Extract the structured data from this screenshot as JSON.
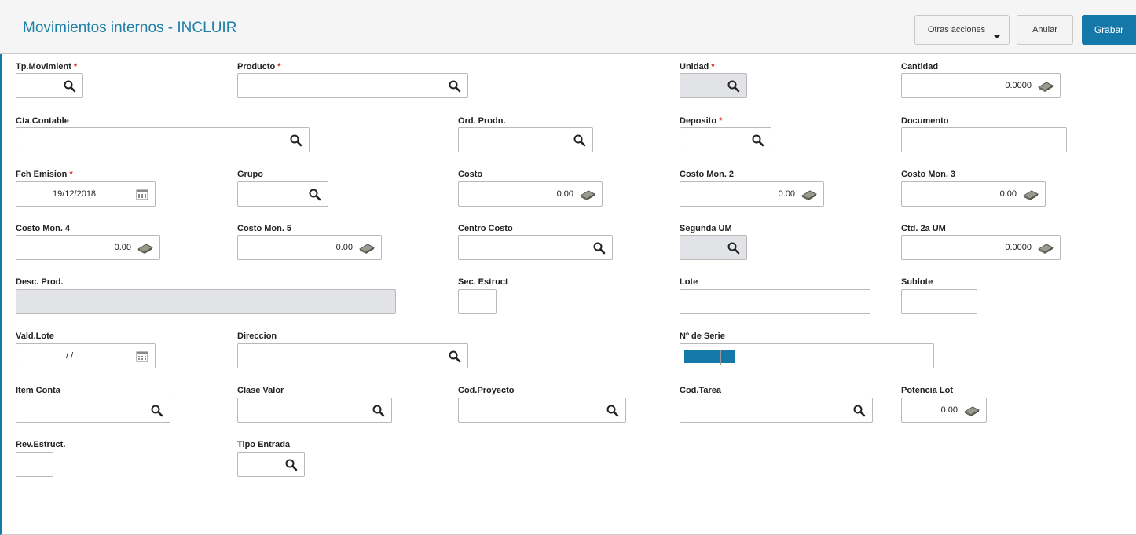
{
  "header": {
    "title": "Movimientos internos - INCLUIR",
    "buttons": {
      "more": "Otras acciones",
      "cancel": "Anular",
      "save": "Grabar"
    }
  },
  "required_mark": "*",
  "fields": {
    "tp_movimiento": {
      "label": "Tp.Movimient",
      "value": ""
    },
    "producto": {
      "label": "Producto",
      "value": ""
    },
    "unidad": {
      "label": "Unidad",
      "value": ""
    },
    "cantidad": {
      "label": "Cantidad",
      "value": "0.0000"
    },
    "cta_contable": {
      "label": "Cta.Contable",
      "value": ""
    },
    "ord_prodn": {
      "label": "Ord. Prodn.",
      "value": ""
    },
    "deposito": {
      "label": "Deposito",
      "value": ""
    },
    "documento": {
      "label": "Documento",
      "value": ""
    },
    "fch_emision": {
      "label": "Fch Emision",
      "value": "19/12/2018"
    },
    "grupo": {
      "label": "Grupo",
      "value": ""
    },
    "costo": {
      "label": "Costo",
      "value": "0.00"
    },
    "costo_mon2": {
      "label": "Costo Mon. 2",
      "value": "0.00"
    },
    "costo_mon3": {
      "label": "Costo Mon. 3",
      "value": "0.00"
    },
    "costo_mon4": {
      "label": "Costo Mon. 4",
      "value": "0.00"
    },
    "costo_mon5": {
      "label": "Costo Mon. 5",
      "value": "0.00"
    },
    "centro_costo": {
      "label": "Centro Costo",
      "value": ""
    },
    "segunda_um": {
      "label": "Segunda UM",
      "value": ""
    },
    "ctd_2a_um": {
      "label": "Ctd. 2a UM",
      "value": "0.0000"
    },
    "desc_prod": {
      "label": "Desc. Prod.",
      "value": ""
    },
    "sec_estruct": {
      "label": "Sec. Estruct",
      "value": ""
    },
    "lote": {
      "label": "Lote",
      "value": ""
    },
    "sublote": {
      "label": "Sublote",
      "value": ""
    },
    "vald_lote": {
      "label": "Vald.Lote",
      "value": "/ /"
    },
    "direccion": {
      "label": "Direccion",
      "value": ""
    },
    "n_serie": {
      "label": "Nº de Serie",
      "value": ""
    },
    "item_conta": {
      "label": "Item Conta",
      "value": ""
    },
    "clase_valor": {
      "label": "Clase Valor",
      "value": ""
    },
    "cod_proyecto": {
      "label": "Cod.Proyecto",
      "value": ""
    },
    "cod_tarea": {
      "label": "Cod.Tarea",
      "value": ""
    },
    "potencia_lot": {
      "label": "Potencia Lot",
      "value": "0.00"
    },
    "rev_estruct": {
      "label": "Rev.Estruct.",
      "value": ""
    },
    "tipo_entrada": {
      "label": "Tipo Entrada",
      "value": ""
    }
  },
  "colors": {
    "accent": "#1478a8",
    "title": "#1e7fa8",
    "required": "#d6262b",
    "readonly_bg": "#e1e3e6"
  },
  "icons": {
    "lookup": "search-icon",
    "calculator": "calculator-icon",
    "calendar": "calendar-icon",
    "dropdown": "chevron-down-icon"
  }
}
